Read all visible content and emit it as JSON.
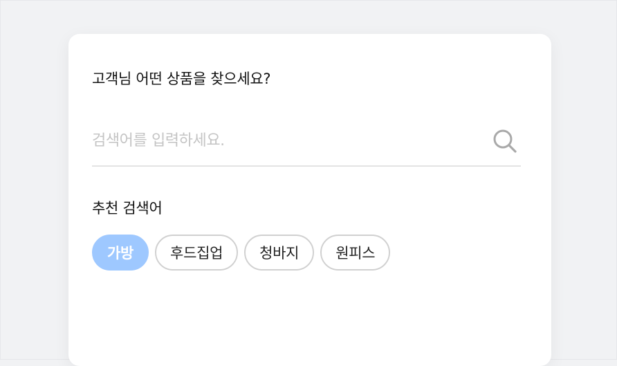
{
  "search_panel": {
    "title": "고객님 어떤 상품을 찾으세요?",
    "search": {
      "placeholder": "검색어를 입력하세요.",
      "value": ""
    },
    "recommend_title": "추천 검색어",
    "chips": [
      {
        "label": "가방",
        "active": true
      },
      {
        "label": "후드집업",
        "active": false
      },
      {
        "label": "청바지",
        "active": false
      },
      {
        "label": "원피스",
        "active": false
      }
    ]
  },
  "colors": {
    "page_background": "#f1f2f4",
    "panel_background": "#ffffff",
    "chip_active": "#9ec8ff",
    "chip_border": "#d0d0d0",
    "placeholder": "#c4c4c4"
  },
  "icons": {
    "search": "search-icon"
  }
}
